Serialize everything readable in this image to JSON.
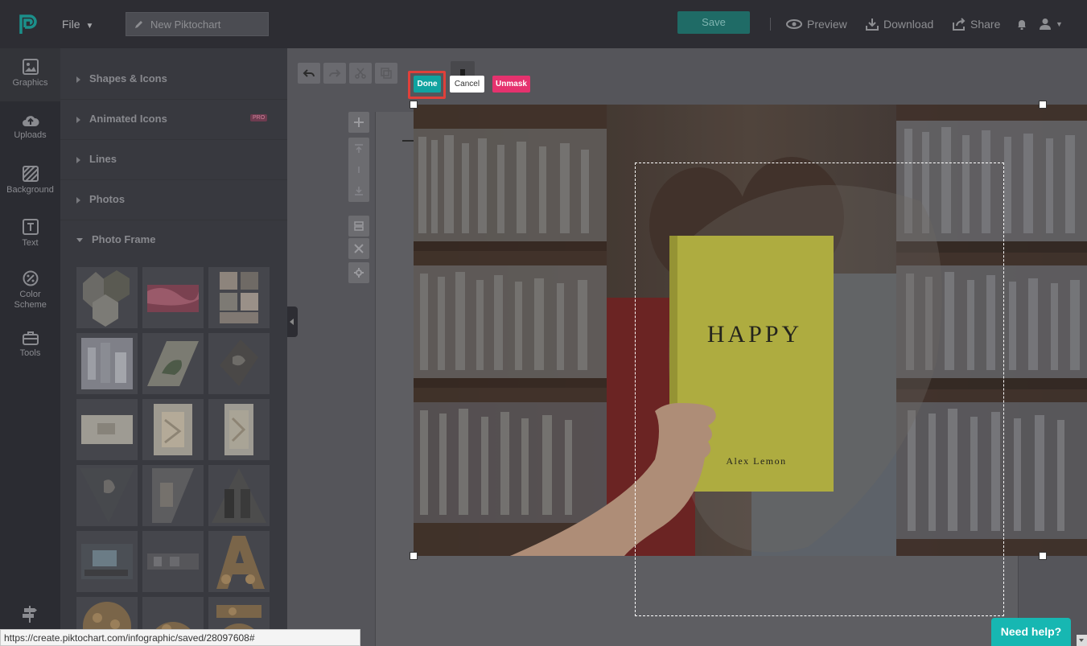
{
  "topbar": {
    "file_menu": "File",
    "title_placeholder": "New Piktochart",
    "save_label": "Save",
    "preview_label": "Preview",
    "download_label": "Download",
    "share_label": "Share"
  },
  "rail": {
    "items": [
      {
        "label": "Graphics",
        "icon": "image-icon"
      },
      {
        "label": "Uploads",
        "icon": "cloud-upload-icon"
      },
      {
        "label": "Background",
        "icon": "background-icon"
      },
      {
        "label": "Text",
        "icon": "text-icon"
      },
      {
        "label": "Color Scheme",
        "icon": "palette-icon"
      },
      {
        "label": "Tools",
        "icon": "toolbox-icon"
      }
    ]
  },
  "panel": {
    "categories": [
      {
        "label": "Shapes & Icons"
      },
      {
        "label": "Animated Icons"
      },
      {
        "label": "Lines"
      },
      {
        "label": "Photos"
      },
      {
        "label": "Photo Frame"
      }
    ],
    "pro_badge": "PRO"
  },
  "mask_actions": {
    "done": "Done",
    "cancel": "Cancel",
    "unmask": "Unmask"
  },
  "photo": {
    "book_title": "HAPPY",
    "book_author": "Alex Lemon"
  },
  "status": {
    "url": "https://create.piktochart.com/infographic/saved/28097608#"
  },
  "help_label": "Need help?",
  "colors": {
    "accent": "#10a3a0",
    "unmask": "#e5326e",
    "highlight": "#e0403a"
  }
}
